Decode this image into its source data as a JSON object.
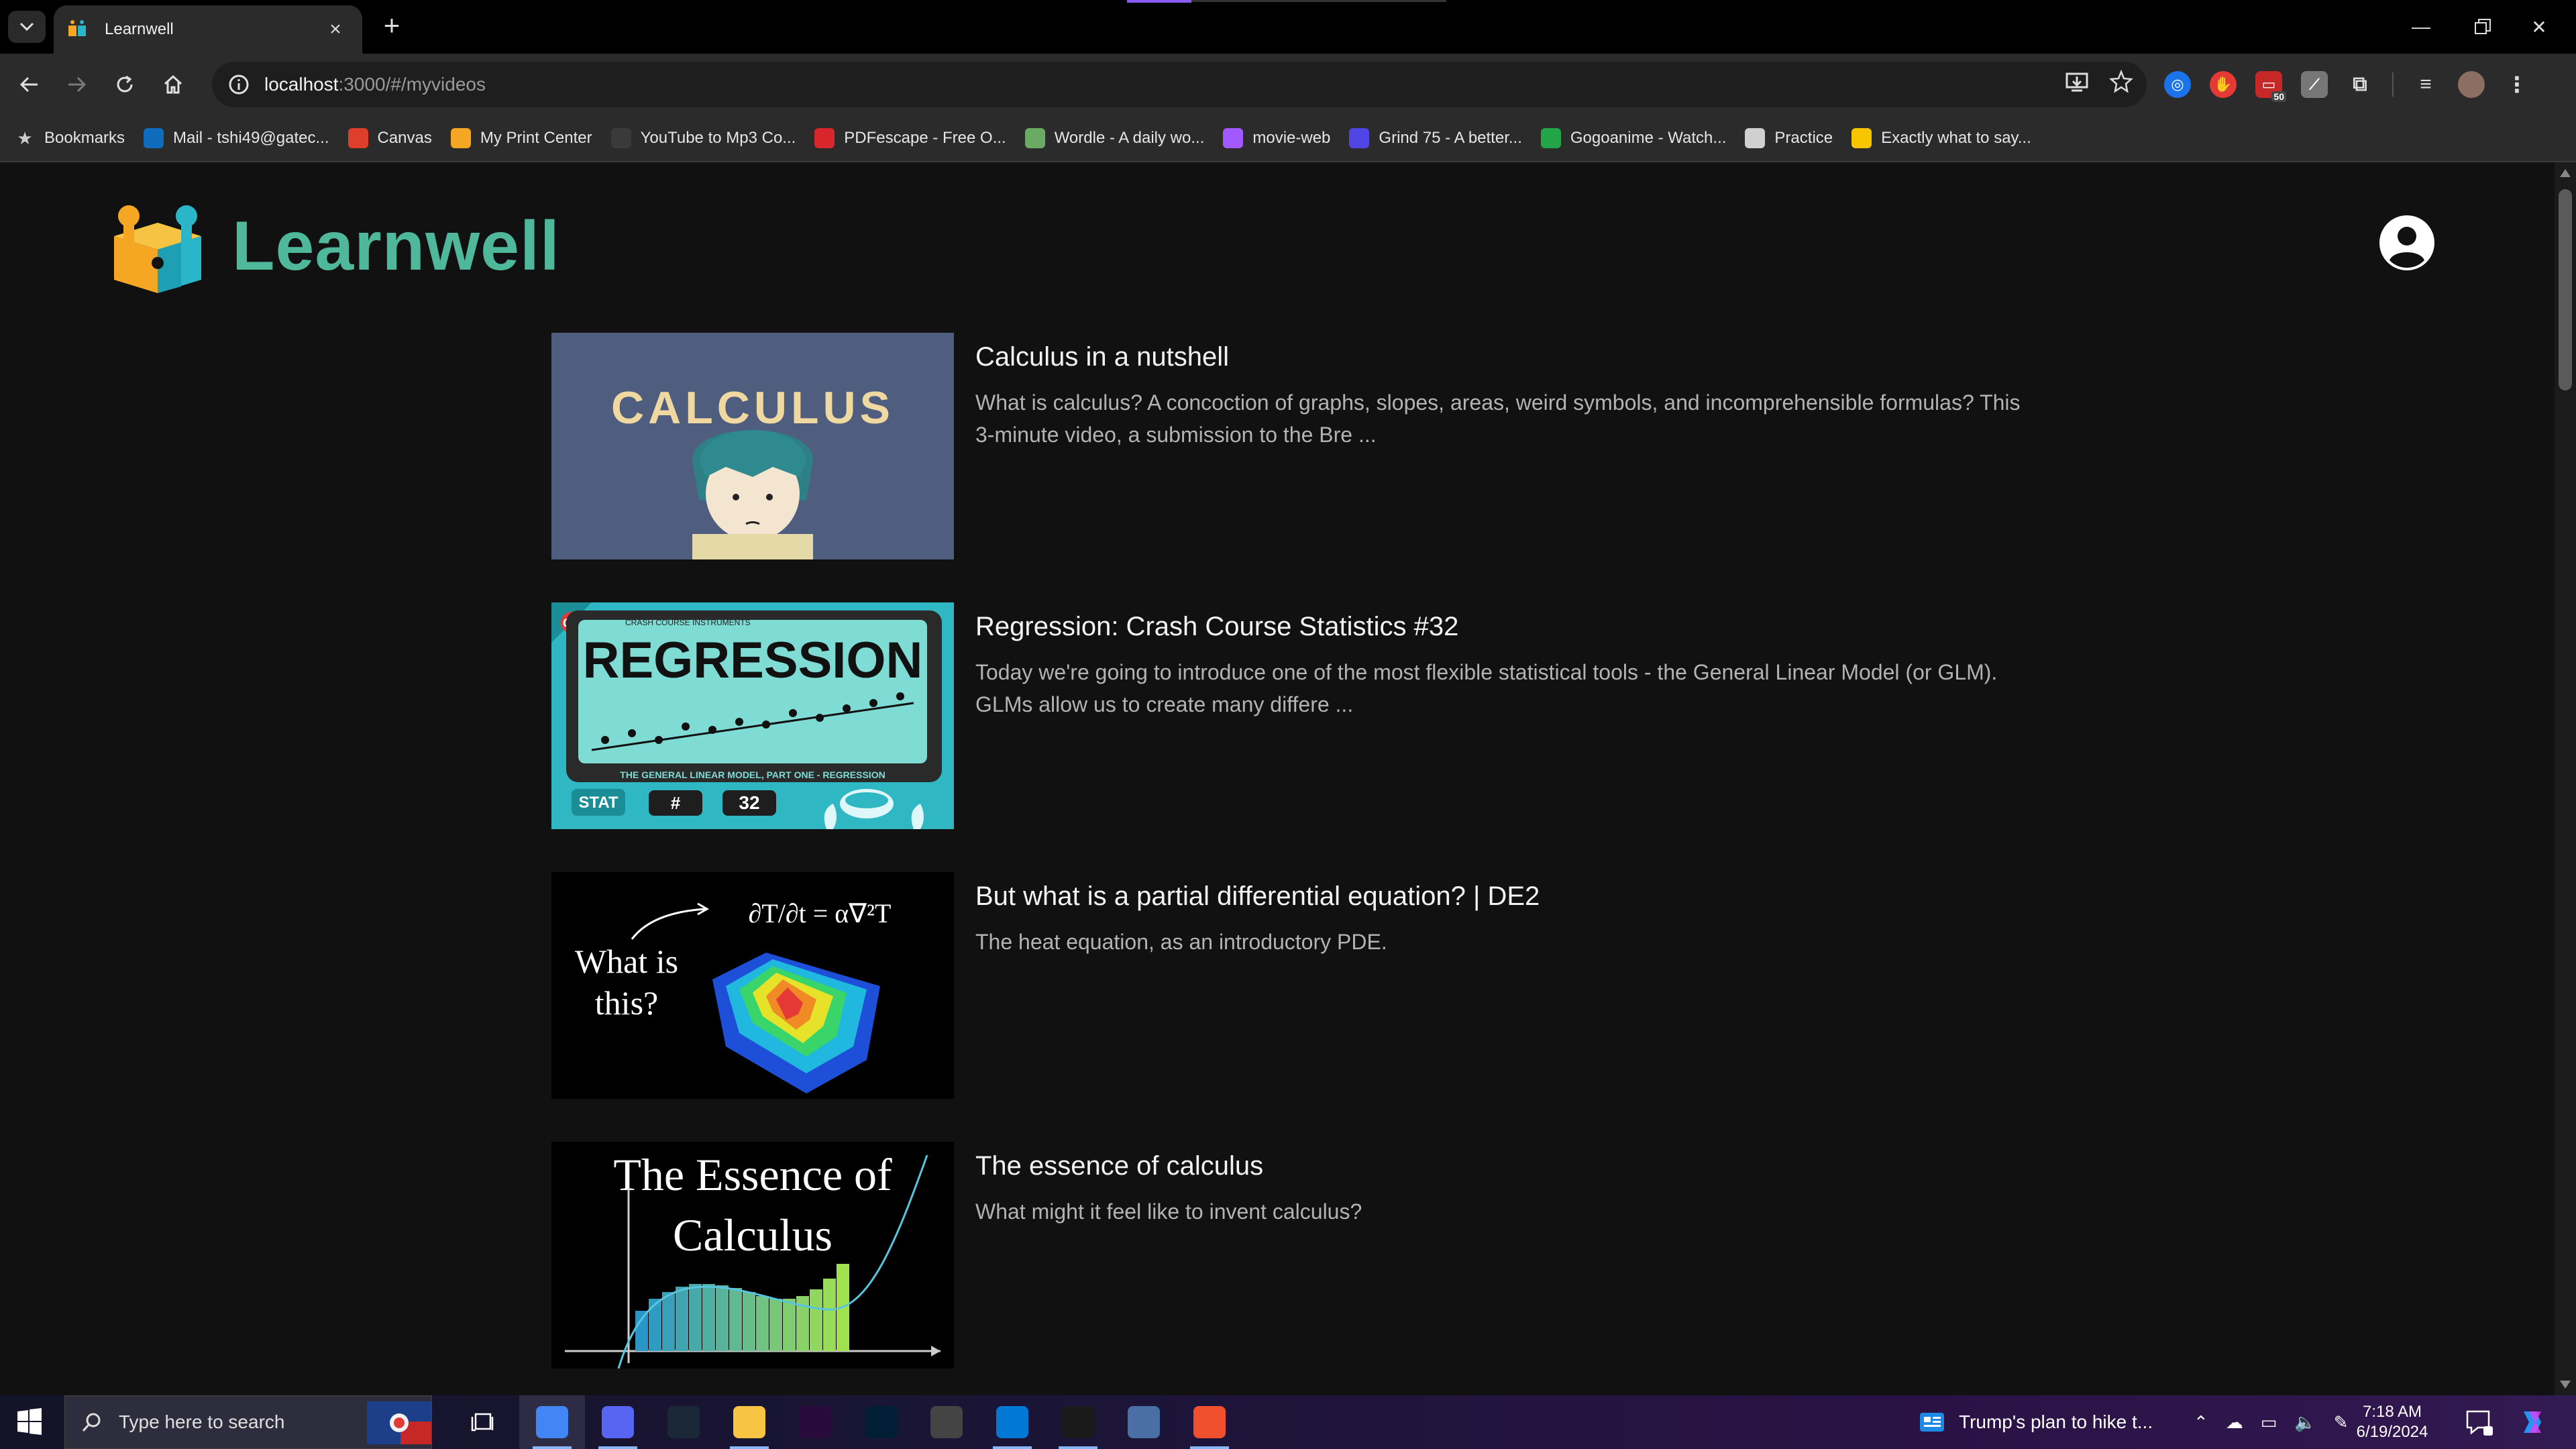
{
  "browser": {
    "tab_title": "Learnwell",
    "url_host": "localhost",
    "url_path": ":3000/#/myvideos",
    "bookmarks": [
      {
        "label": "Bookmarks",
        "icon": "star-icon",
        "color": "#cccccc"
      },
      {
        "label": "Mail - tshi49@gatec...",
        "icon": "outlook-icon",
        "color": "#0f6cbd"
      },
      {
        "label": "Canvas",
        "icon": "canvas-icon",
        "color": "#e03e2d"
      },
      {
        "label": "My Print Center",
        "icon": "hand-icon",
        "color": "#f5a623"
      },
      {
        "label": "YouTube to Mp3 Co...",
        "icon": "download-icon",
        "color": "#3a3a3a"
      },
      {
        "label": "PDFescape - Free O...",
        "icon": "pdf-icon",
        "color": "#d9262c"
      },
      {
        "label": "Wordle - A daily wo...",
        "icon": "wordle-icon",
        "color": "#6aaa64"
      },
      {
        "label": "movie-web",
        "icon": "movie-icon",
        "color": "#a259ff"
      },
      {
        "label": "Grind 75 - A better...",
        "icon": "grind-icon",
        "color": "#4f46e5"
      },
      {
        "label": "Gogoanime - Watch...",
        "icon": "gogo-icon",
        "color": "#22a447"
      },
      {
        "label": "Practice",
        "icon": "pin-icon",
        "color": "#d0d0d0"
      },
      {
        "label": "Exactly what to say...",
        "icon": "smile-icon",
        "color": "#f7c600"
      }
    ]
  },
  "header": {
    "logo_text": "Learnwell",
    "brand_color": "#4fb89a"
  },
  "videos": [
    {
      "title": "Calculus in a nutshell",
      "description": "What is calculus? A concoction of graphs, slopes, areas, weird symbols, and incomprehensible formulas? This 3-minute video, a submission to the Bre ...",
      "thumb_text": "CALCULUS"
    },
    {
      "title": "Regression: Crash Course Statistics #32",
      "description": "Today we're going to introduce one of the most flexible statistical tools - the General Linear Model (or GLM). GLMs allow us to create many differe ...",
      "thumb_text": "REGRESSION",
      "thumb_sub": "THE GENERAL LINEAR MODEL, PART ONE - REGRESSION",
      "thumb_badge_stat": "STAT",
      "thumb_badge_hash": "#",
      "thumb_badge_num": "32",
      "thumb_cc": "CC",
      "thumb_header": "CRASH COURSE INSTRUMENTS"
    },
    {
      "title": "But what is a partial differential equation? | DE2",
      "description": "The heat equation, as an introductory PDE.",
      "thumb_text_1": "What is",
      "thumb_text_2": "this?",
      "thumb_eq": "∂T/∂t = α∇²T"
    },
    {
      "title": "The essence of calculus",
      "description": "What might it feel like to invent calculus?",
      "thumb_text_1": "The Essence of",
      "thumb_text_2": "Calculus"
    }
  ],
  "taskbar": {
    "search_placeholder": "Type here to search",
    "news_text": "Trump's plan to hike t...",
    "time": "7:18 AM",
    "date": "6/19/2024",
    "apps": [
      {
        "name": "chrome-icon",
        "color": "#4285f4"
      },
      {
        "name": "discord-icon",
        "color": "#5865f2"
      },
      {
        "name": "steam-icon",
        "color": "#1b2838"
      },
      {
        "name": "file-explorer-icon",
        "color": "#f8c444"
      },
      {
        "name": "premiere-icon",
        "color": "#2a0a3d"
      },
      {
        "name": "photoshop-icon",
        "color": "#001e36"
      },
      {
        "name": "settings-gear-icon",
        "color": "#444444"
      },
      {
        "name": "vscode-icon",
        "color": "#0078d4"
      },
      {
        "name": "terminal-icon",
        "color": "#1a1a1a"
      },
      {
        "name": "calculator-icon",
        "color": "#4a6fa5"
      },
      {
        "name": "git-icon",
        "color": "#f1502f"
      }
    ]
  }
}
